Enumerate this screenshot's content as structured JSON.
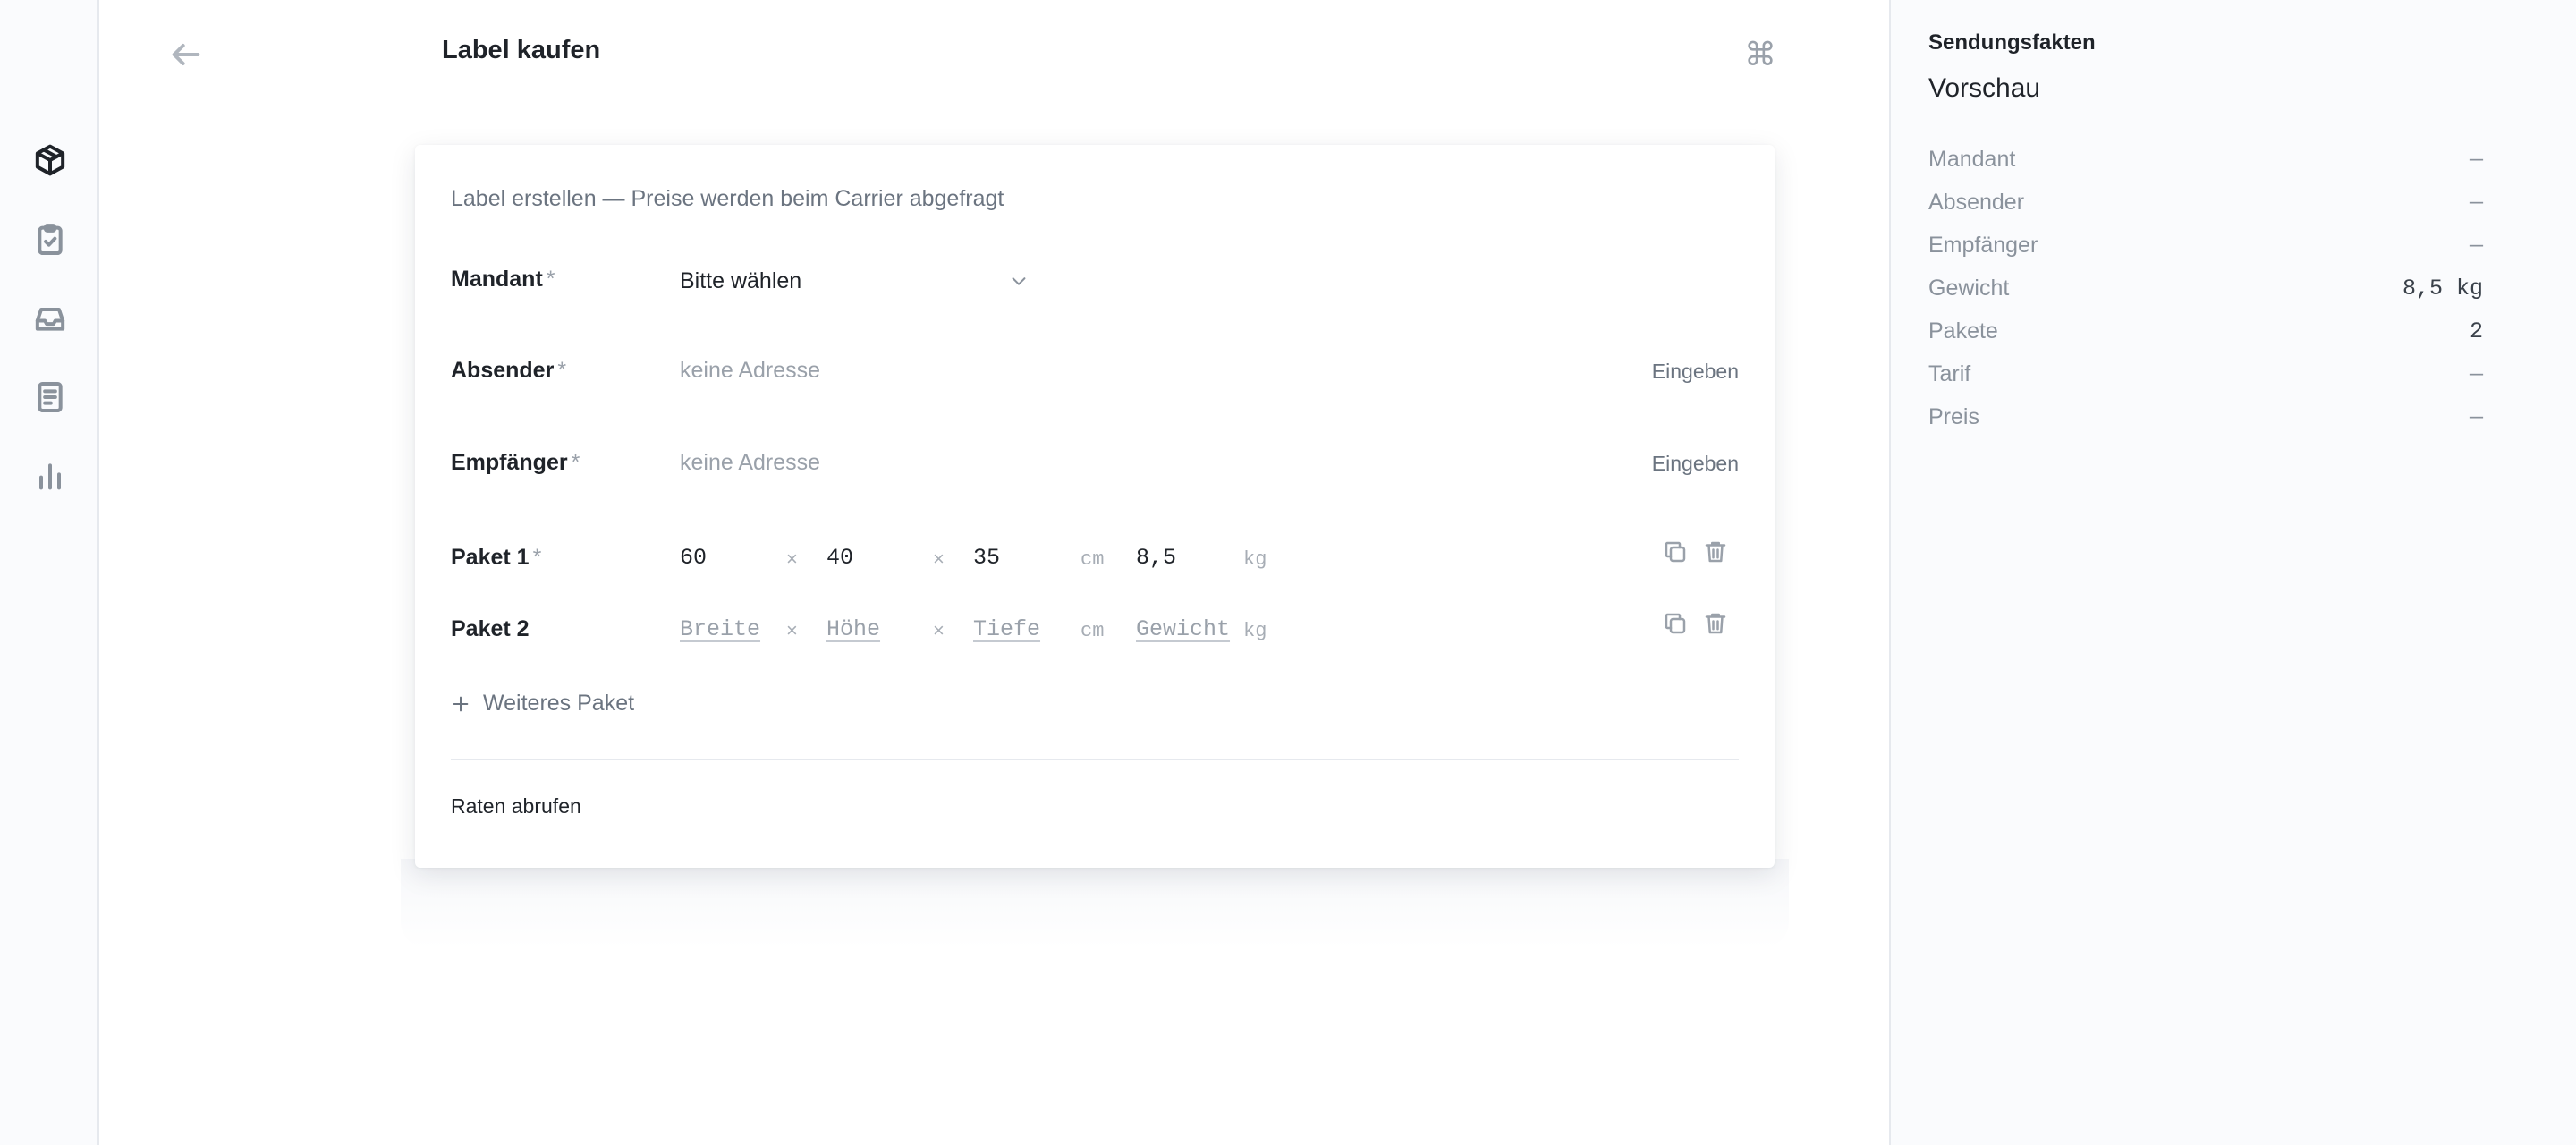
{
  "rail": {
    "items": [
      {
        "icon": "package-icon",
        "active": true
      },
      {
        "icon": "clipboard-check-icon",
        "active": false
      },
      {
        "icon": "inbox-icon",
        "active": false
      },
      {
        "icon": "document-icon",
        "active": false
      },
      {
        "icon": "bar-chart-icon",
        "active": false
      }
    ]
  },
  "header": {
    "title": "Label kaufen",
    "back_icon": "arrow-left-icon",
    "command_glyph": "⌘"
  },
  "form": {
    "intro": "Label erstellen — Preise werden beim Carrier abgefragt",
    "required_mark": "*",
    "mandant": {
      "label": "Mandant",
      "value": "Bitte wählen"
    },
    "absender": {
      "label": "Absender",
      "placeholder": "keine Adresse",
      "action": "Eingeben"
    },
    "empfaenger": {
      "label": "Empfänger",
      "placeholder": "keine Adresse",
      "action": "Eingeben"
    },
    "packages": [
      {
        "label": "Paket 1",
        "required": true,
        "width": "60",
        "height": "40",
        "depth": "35",
        "weight": "8,5"
      },
      {
        "label": "Paket 2",
        "required": false,
        "width_placeholder": "Breite",
        "height_placeholder": "Höhe",
        "depth_placeholder": "Tiefe",
        "weight_placeholder": "Gewicht"
      }
    ],
    "times": "×",
    "unit_length": "cm",
    "unit_weight": "kg",
    "add_package": "Weiteres Paket",
    "rates_button": "Raten abrufen"
  },
  "panel": {
    "eyebrow": "Sendungsfakten",
    "title": "Vorschau",
    "facts": [
      {
        "key": "Mandant",
        "value": "—"
      },
      {
        "key": "Absender",
        "value": "—"
      },
      {
        "key": "Empfänger",
        "value": "—"
      },
      {
        "key": "Gewicht",
        "value": "8,5 kg"
      },
      {
        "key": "Pakete",
        "value": "2"
      },
      {
        "key": "Tarif",
        "value": "—"
      },
      {
        "key": "Preis",
        "value": "—"
      }
    ]
  },
  "colors": {
    "text": "#1f2329",
    "muted": "#9aa1aa",
    "border": "#e6e9ee",
    "panel_bg": "#fafbfd"
  }
}
